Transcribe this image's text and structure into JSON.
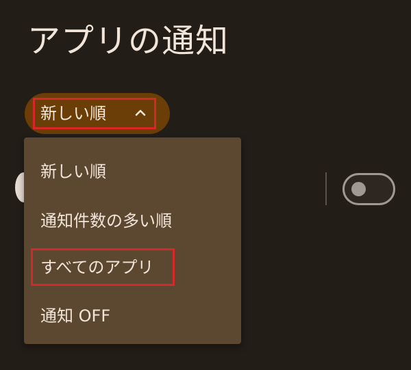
{
  "page": {
    "title": "アプリの通知"
  },
  "sort": {
    "selected_label": "新しい順",
    "chevron_icon": "chevron-up-icon",
    "expanded": true
  },
  "menu": {
    "items": [
      {
        "label": "新しい順"
      },
      {
        "label": "通知件数の多い順"
      },
      {
        "label": "すべてのアプリ",
        "highlighted": true
      },
      {
        "label": "通知 OFF"
      }
    ]
  },
  "toggle": {
    "state": "off"
  },
  "colors": {
    "background": "#231d18",
    "chip": "#6a3e06",
    "menu": "#5c4731",
    "highlight": "#d62828",
    "text": "#f1e4d8"
  }
}
